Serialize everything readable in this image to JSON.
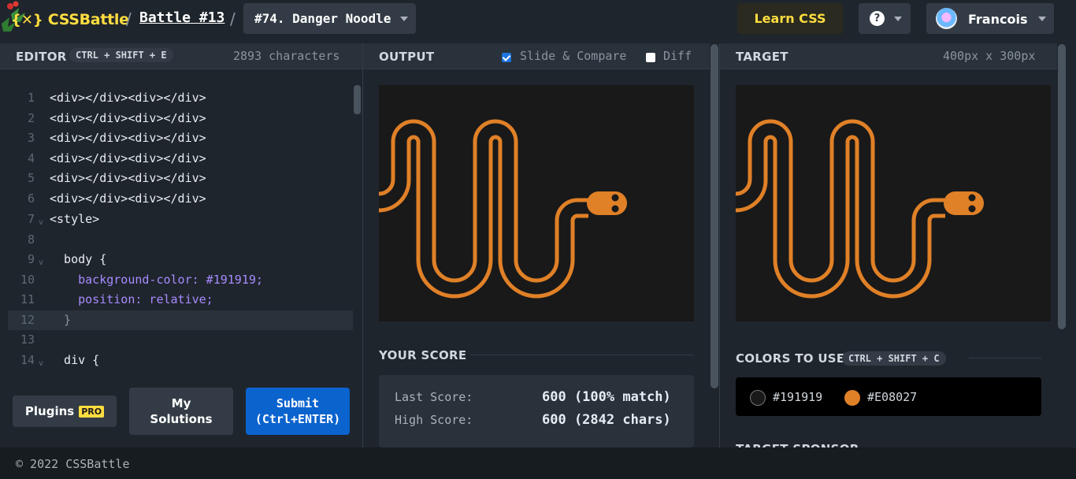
{
  "header": {
    "logo_mark": "{✕}",
    "logo_text": "CSSBattle",
    "separator": "/",
    "battle_label": "Battle #13",
    "target_select": "#74. Danger Noodle",
    "learn_label": "Learn CSS",
    "help_label": "?",
    "user_name": "Francois"
  },
  "editor": {
    "title": "EDITOR",
    "shortcut": "CTRL + SHIFT + E",
    "char_count": "2893 characters",
    "lines": [
      {
        "n": "1",
        "text": "<div></div><div></div>"
      },
      {
        "n": "2",
        "text": "<div></div><div></div>"
      },
      {
        "n": "3",
        "text": "<div></div><div></div>"
      },
      {
        "n": "4",
        "text": "<div></div><div></div>"
      },
      {
        "n": "5",
        "text": "<div></div><div></div>"
      },
      {
        "n": "6",
        "text": "<div></div><div></div>"
      },
      {
        "n": "7",
        "text": "<style>"
      },
      {
        "n": "8",
        "text": ""
      },
      {
        "n": "9",
        "text": "  body {"
      },
      {
        "n": "10",
        "text": "    background-color: #191919;"
      },
      {
        "n": "11",
        "text": "    position: relative;"
      },
      {
        "n": "12",
        "text": "  }"
      },
      {
        "n": "13",
        "text": ""
      },
      {
        "n": "14",
        "text": "  div {"
      }
    ],
    "plugins_label": "Plugins",
    "pro_badge": "PRO",
    "solutions_label_1": "My",
    "solutions_label_2": "Solutions",
    "submit_label_1": "Submit",
    "submit_label_2": "(Ctrl+ENTER)"
  },
  "output": {
    "title": "OUTPUT",
    "slide_compare_label": "Slide & Compare",
    "slide_compare_checked": true,
    "diff_label": "Diff",
    "diff_checked": false
  },
  "score": {
    "title": "YOUR SCORE",
    "last_label": "Last Score:",
    "last_value": "600 (100% match)",
    "high_label": "High Score:",
    "high_value": "600 (2842 chars)"
  },
  "target": {
    "title": "TARGET",
    "size": "400px x 300px",
    "colors_title": "COLORS TO USE",
    "colors_shortcut": "CTRL + SHIFT + C",
    "colors": [
      {
        "hex": "#191919",
        "label": "#191919"
      },
      {
        "hex": "#E08027",
        "label": "#E08027"
      }
    ],
    "sponsor_title": "TARGET SPONSOR"
  },
  "footer": {
    "copyright": "© 2022 CSSBattle"
  }
}
